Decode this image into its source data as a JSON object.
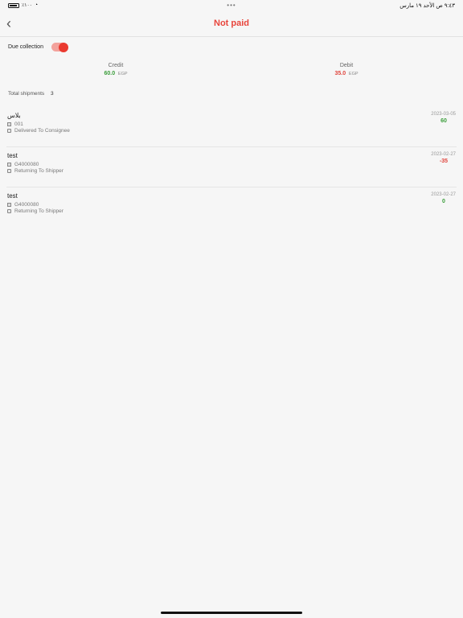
{
  "status_bar": {
    "time_date": "٩:٤٣ ص  الأحد ١٩ مارس",
    "battery_pct": "٪١٠٠",
    "dots": "•••"
  },
  "header": {
    "title": "Not paid"
  },
  "due_collection": {
    "label": "Due collection",
    "enabled": true
  },
  "summary": {
    "credit_label": "Credit",
    "credit_value": "60.0",
    "credit_currency": "EGP",
    "debit_label": "Debit",
    "debit_value": "35.0",
    "debit_currency": "EGP"
  },
  "total": {
    "label": "Total shipments",
    "count": "3"
  },
  "shipments": [
    {
      "title": "بلاس",
      "code": "001",
      "status": "Delivered To Consignee",
      "date": "2023-03-05",
      "amount": "60"
    },
    {
      "title": "test",
      "code": "G4000080",
      "status": "Returning To Shipper",
      "date": "2023-02-27",
      "amount": "-35"
    },
    {
      "title": "test",
      "code": "G4000080",
      "status": "Returning To Shipper",
      "date": "2023-02-27",
      "amount": "0"
    }
  ]
}
